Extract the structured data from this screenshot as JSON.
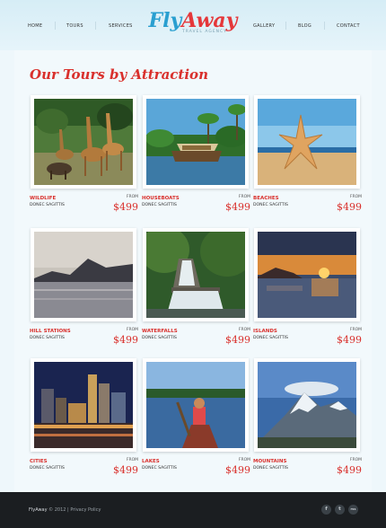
{
  "nav": {
    "left": [
      "HOME",
      "TOURS",
      "SERVICES"
    ],
    "right": [
      "GALLERY",
      "BLOG",
      "CONTACT"
    ]
  },
  "logo": {
    "fly": "Fly",
    "away": "Away",
    "tagline": "TRAVEL AGENCY"
  },
  "page_title": "Our Tours by Attraction",
  "tours": [
    {
      "name": "WILDLIFE",
      "subtitle": "DONEC SAGITTIS",
      "from": "FROM",
      "price": "$499"
    },
    {
      "name": "HOUSEBOATS",
      "subtitle": "DONEC SAGITTIS",
      "from": "FROM",
      "price": "$499"
    },
    {
      "name": "BEACHES",
      "subtitle": "DONEC SAGITTIS",
      "from": "FROM",
      "price": "$499"
    },
    {
      "name": "HILL STATIONS",
      "subtitle": "DONEC SAGITTIS",
      "from": "FROM",
      "price": "$499"
    },
    {
      "name": "WATERFALLS",
      "subtitle": "DONEC SAGITTIS",
      "from": "FROM",
      "price": "$499"
    },
    {
      "name": "ISLANDS",
      "subtitle": "DONEC SAGITTIS",
      "from": "FROM",
      "price": "$499"
    },
    {
      "name": "CITIES",
      "subtitle": "DONEC SAGITTIS",
      "from": "FROM",
      "price": "$499"
    },
    {
      "name": "LAKES",
      "subtitle": "DONEC SAGITTIS",
      "from": "FROM",
      "price": "$499"
    },
    {
      "name": "MOUNTAINS",
      "subtitle": "DONEC SAGITTIS",
      "from": "FROM",
      "price": "$499"
    }
  ],
  "footer": {
    "brand": "FlyAway",
    "copyright": " © 2012 | Privacy Policy"
  },
  "social": [
    "f",
    "t",
    "rss"
  ],
  "colors": {
    "accent": "#d9302c",
    "brand_blue": "#2a9fd0",
    "footer": "#1b1e21"
  }
}
